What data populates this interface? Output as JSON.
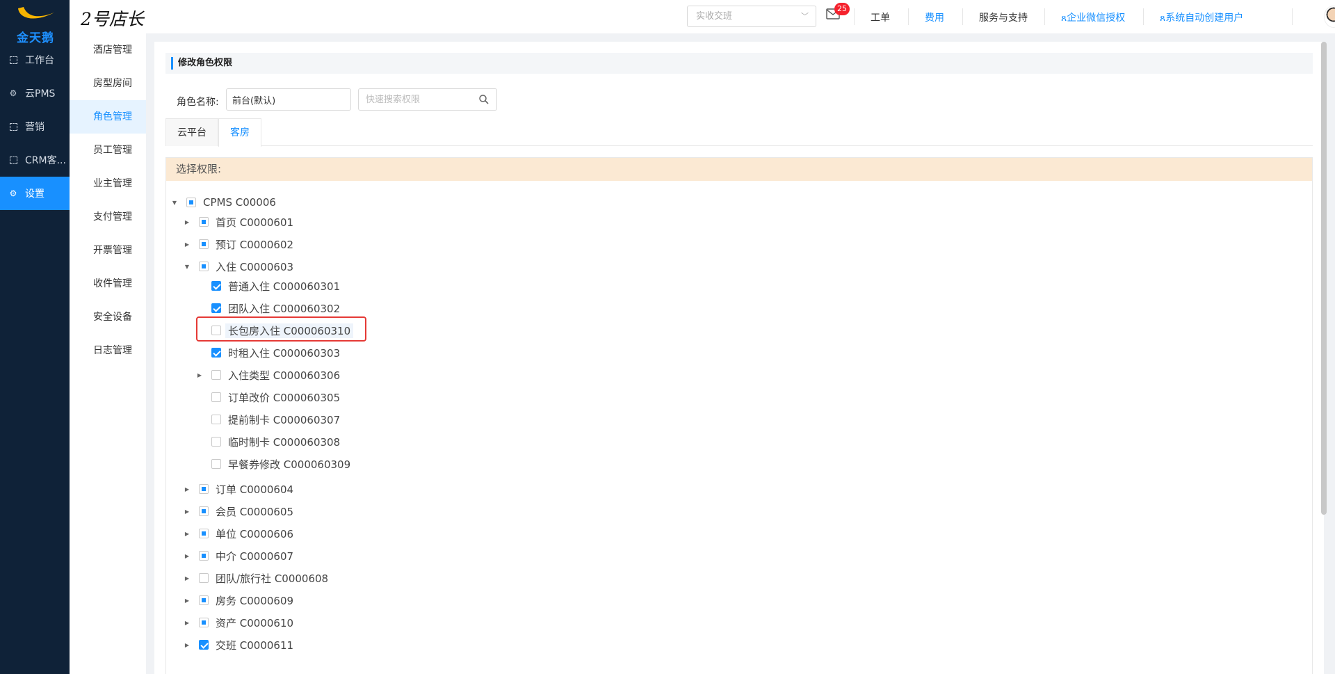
{
  "app": {
    "logo_text": "金天鹅",
    "brand": "2号店长"
  },
  "left_nav": [
    {
      "label": "工作台",
      "icon": "bracket-icon"
    },
    {
      "label": "云PMS",
      "icon": "gear-icon"
    },
    {
      "label": "营销",
      "icon": "bracket-icon"
    },
    {
      "label": "CRM客...",
      "icon": "bracket-icon"
    },
    {
      "label": "设置",
      "icon": "gear-icon",
      "active": true
    }
  ],
  "topbar": {
    "shift_placeholder": "实收交班",
    "mail_badge": "25",
    "links": {
      "ticket": "工单",
      "fee": "费用",
      "service": "服务与支持",
      "wechat": "企业微信授权",
      "user": "系统自动创建用户"
    }
  },
  "submenu": [
    "酒店管理",
    "房型房间",
    "角色管理",
    "员工管理",
    "业主管理",
    "支付管理",
    "开票管理",
    "收件管理",
    "安全设备",
    "日志管理"
  ],
  "form": {
    "section_title": "修改角色权限",
    "role_label": "角色名称:",
    "role_value": "前台(默认)",
    "search_placeholder": "快速搜索权限",
    "tabs": [
      "云平台",
      "客房"
    ],
    "perm_header": "选择权限:"
  },
  "tree": {
    "root": "CPMS C00006",
    "n601": "首页 C0000601",
    "n602": "预订 C0000602",
    "n603": "入住 C0000603",
    "n60301": "普通入住 C000060301",
    "n60302": "团队入住 C000060302",
    "n60310": "长包房入住 C000060310",
    "n60303": "时租入住 C000060303",
    "n60306": "入住类型 C000060306",
    "n60305": "订单改价 C000060305",
    "n60307": "提前制卡 C000060307",
    "n60308": "临时制卡 C000060308",
    "n60309": "早餐券修改 C000060309",
    "n604": "订单 C0000604",
    "n605": "会员 C0000605",
    "n606": "单位 C0000606",
    "n607": "中介 C0000607",
    "n608": "团队/旅行社 C0000608",
    "n609": "房务 C0000609",
    "n610": "资产 C0000610",
    "n611": "交班 C0000611"
  },
  "colors": {
    "nav_bg": "#0f2238",
    "accent": "#1890ff",
    "header_tint": "#fbe9d3",
    "highlight_border": "#e53935"
  }
}
